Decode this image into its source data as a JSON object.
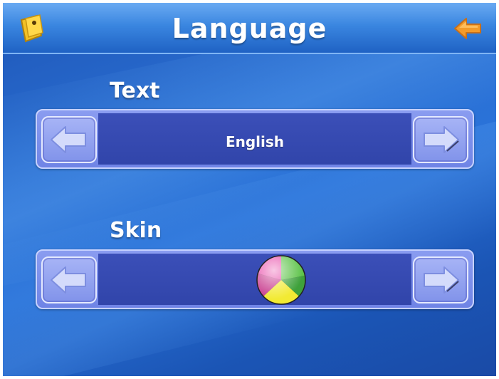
{
  "header": {
    "title": "Language",
    "home_icon": "folder-home-icon",
    "back_icon": "back-arrow-icon"
  },
  "text_section": {
    "label": "Text",
    "value": "English",
    "prev_icon": "arrow-left-icon",
    "next_icon": "arrow-right-icon"
  },
  "skin_section": {
    "label": "Skin",
    "preview_icon": "skin-color-ball-icon",
    "prev_icon": "arrow-left-icon",
    "next_icon": "arrow-right-icon"
  },
  "colors": {
    "background": "#2a6fd3",
    "title_bar": "#3a86e0",
    "selector": "#6f84e6",
    "selector_inner": "#3145aa",
    "back_arrow": "#f39b2a"
  }
}
